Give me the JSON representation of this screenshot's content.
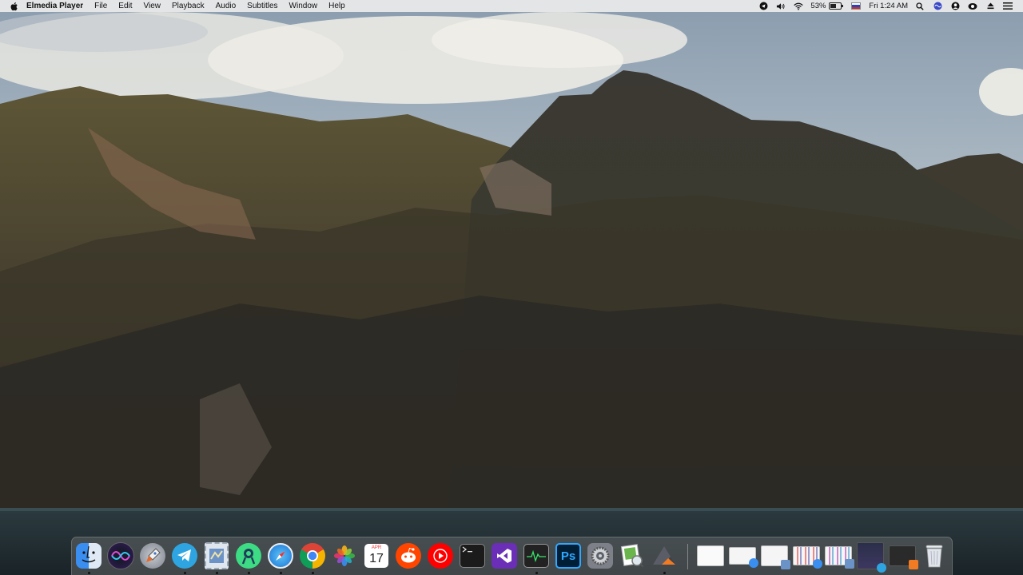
{
  "menubar": {
    "app_name": "Elmedia Player",
    "menus": [
      "File",
      "Edit",
      "View",
      "Playback",
      "Audio",
      "Subtitles",
      "Window",
      "Help"
    ],
    "status": {
      "battery_percent": "53%",
      "battery_level": 0.53,
      "clock": "Fri 1:24 AM"
    }
  },
  "dock": {
    "apps": [
      {
        "name": "finder-icon",
        "running": true
      },
      {
        "name": "siri-icon",
        "running": false
      },
      {
        "name": "launchpad-icon",
        "running": false
      },
      {
        "name": "telegram-icon",
        "running": true
      },
      {
        "name": "mail-icon",
        "running": true
      },
      {
        "name": "android-studio-icon",
        "running": true
      },
      {
        "name": "safari-icon",
        "running": true
      },
      {
        "name": "chrome-icon",
        "running": true
      },
      {
        "name": "photos-icon",
        "running": false
      },
      {
        "name": "calendar-icon",
        "running": false
      },
      {
        "name": "reddit-icon",
        "running": false
      },
      {
        "name": "youtube-music-icon",
        "running": false
      },
      {
        "name": "terminal-icon",
        "running": false
      },
      {
        "name": "visual-studio-icon",
        "running": false
      },
      {
        "name": "activity-monitor-icon",
        "running": true
      },
      {
        "name": "photoshop-icon",
        "running": false
      },
      {
        "name": "system-preferences-icon",
        "running": false
      },
      {
        "name": "preview-icon",
        "running": false
      },
      {
        "name": "elmedia-player-icon",
        "running": true
      }
    ],
    "calendar": {
      "month": "APR",
      "day": "17"
    },
    "photoshop_label": "Ps",
    "minimized_windows": [
      {
        "name": "minimized-window-1"
      },
      {
        "name": "minimized-window-2"
      },
      {
        "name": "minimized-window-3"
      },
      {
        "name": "minimized-window-4"
      },
      {
        "name": "minimized-window-5"
      },
      {
        "name": "minimized-window-6"
      },
      {
        "name": "minimized-window-7"
      }
    ],
    "trash": {
      "name": "trash-icon"
    }
  }
}
